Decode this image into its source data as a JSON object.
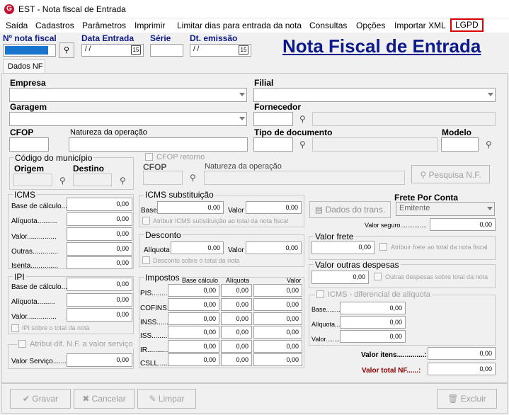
{
  "window": {
    "title": "EST - Nota fiscal de Entrada"
  },
  "menu": [
    "Saída",
    "Cadastros",
    "Parâmetros",
    "Imprimir",
    "Limitar dias para entrada da nota",
    "Consultas",
    "Opções",
    "Importar XML",
    "LGPD"
  ],
  "header": {
    "nota_label": "Nº nota fiscal",
    "data_entrada_label": "Data Entrada",
    "data_entrada_value": " / /",
    "serie_label": "Série",
    "dt_emissao_label": "Dt. emissão",
    "dt_emissao_value": " / /",
    "page_title": "Nota Fiscal de Entrada",
    "calendar_glyph": "15"
  },
  "tabs": [
    "Dados NF"
  ],
  "fields": {
    "empresa": "Empresa",
    "filial": "Filial",
    "garagem": "Garagem",
    "fornecedor": "Fornecedor",
    "cfop": "CFOP",
    "natureza": "Natureza da operação",
    "tipo_documento": "Tipo de documento",
    "modelo": "Modelo",
    "codigo_municipio": "Código do município",
    "origem": "Origem",
    "destino": "Destino",
    "cfop_retorno": "CFOP retorno",
    "cfop2": "CFOP",
    "natureza2": "Natureza da operação",
    "pesquisa_nf": "Pesquisa N.F."
  },
  "icms": {
    "title": "ICMS",
    "rows": [
      {
        "label": "Base de cálculo....:",
        "value": "0,00"
      },
      {
        "label": "Alíquota..........",
        "value": "0,00"
      },
      {
        "label": "Valor...............",
        "value": "0,00"
      },
      {
        "label": "Outras.............",
        "value": "0,00"
      },
      {
        "label": "Isenta..............",
        "value": "0,00"
      }
    ]
  },
  "icms_st": {
    "title": "ICMS substituição",
    "base_label": "Base",
    "base_value": "0,00",
    "valor_label": "Valor",
    "valor_value": "0,00",
    "check_label": "Atribuir ICMS substituição ao total da nota fiscal"
  },
  "desconto": {
    "title": "Desconto",
    "aliquota_label": "Alíquota",
    "aliquota_value": "0,00",
    "valor_label": "Valor",
    "valor_value": "0,00",
    "check_label": "Desconto sobre o total da nota"
  },
  "ipi": {
    "title": "IPI",
    "rows": [
      {
        "label": "Base de cálculo....",
        "value": "0,00"
      },
      {
        "label": "Alíquota.........",
        "value": "0,00"
      },
      {
        "label": "Valor...............",
        "value": "0,00"
      }
    ],
    "check_label": "IPI sobre o total da nota"
  },
  "atribui": {
    "check_label": "Atribui dif. N.F. a valor serviço",
    "valor_label": "Valor Serviço..........",
    "valor_value": "0,00"
  },
  "impostos": {
    "title": "Impostos",
    "cols": [
      "Base cálculo",
      "Alíquota",
      "Valor"
    ],
    "rows": [
      {
        "label": "PIS........",
        "values": [
          "0,00",
          "0,00",
          "0,00"
        ]
      },
      {
        "label": "COFINS:",
        "values": [
          "0,00",
          "0,00",
          "0,00"
        ]
      },
      {
        "label": "INSS.......",
        "values": [
          "0,00",
          "0,00",
          "0,00"
        ]
      },
      {
        "label": "ISS.........",
        "values": [
          "0,00",
          "0,00",
          "0,00"
        ]
      },
      {
        "label": "IR...........",
        "values": [
          "0,00",
          "0,00",
          "0,00"
        ]
      },
      {
        "label": "CSLL......",
        "values": [
          "0,00",
          "0,00",
          "0,00"
        ]
      }
    ]
  },
  "frete": {
    "dados_trans": "Dados do trans.",
    "frete_por_conta": "Frete Por Conta",
    "frete_value": "Emitente",
    "valor_seguro_label": "Valor seguro...............",
    "valor_seguro": "0,00"
  },
  "valor_frete": {
    "title": "Valor frete",
    "value": "0,00",
    "check_label": "Atribuir frete ao total da nota fiscal"
  },
  "outras": {
    "title": "Valor outras despesas",
    "value": "0,00",
    "check_label": "Outras despesas sobre total da nota"
  },
  "icms_dif": {
    "title": "ICMS - diferencial de alíquota",
    "rows": [
      {
        "label": "Base..........",
        "value": "0,00"
      },
      {
        "label": "Alíquota........",
        "value": "0,00"
      },
      {
        "label": "Valor............",
        "value": "0,00"
      }
    ]
  },
  "totais": {
    "itens_label": "Valor itens..............:",
    "itens_value": "0,00",
    "total_label": "Valor total NF......:",
    "total_value": "0,00",
    "total_color": "#8b0000"
  },
  "buttons": {
    "gravar": "Gravar",
    "cancelar": "Cancelar",
    "limpar": "Limpar",
    "excluir": "Excluir"
  },
  "colors": {
    "accent": "#0d1a8a",
    "highlight": "#e00000",
    "selected_input": "#1874cd"
  }
}
